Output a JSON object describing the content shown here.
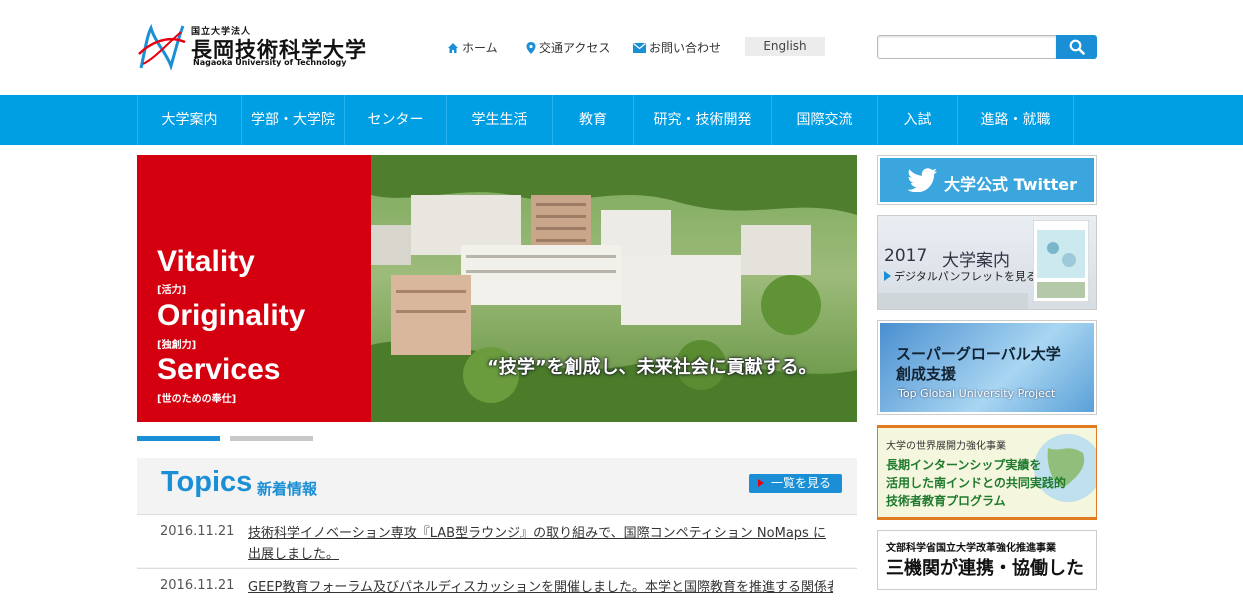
{
  "header": {
    "logo_small": "国立大学法人",
    "logo_main": "長岡技術科学大学",
    "logo_en": "Nagaoka University of Technology",
    "home_label": "ホーム",
    "access_label": "交通アクセス",
    "contact_label": "お問い合わせ",
    "english_label": "English",
    "search_placeholder": ""
  },
  "nav": {
    "items": [
      {
        "label": "大学案内"
      },
      {
        "label": "学部・大学院"
      },
      {
        "label": "センター"
      },
      {
        "label": "学生生活"
      },
      {
        "label": "教育"
      },
      {
        "label": "研究・技術開発"
      },
      {
        "label": "国際交流"
      },
      {
        "label": "入試"
      },
      {
        "label": "進路・就職"
      }
    ]
  },
  "hero": {
    "word1": "Vitality",
    "sub1": "[活力]",
    "word2": "Originality",
    "sub2": "[独創力]",
    "word3": "Services",
    "sub3": "[世のための奉仕]",
    "caption": "“技学”を創成し、未来社会に貢献する。",
    "slide_active": 1,
    "slide_count": 2
  },
  "topics": {
    "title": "Topics",
    "subtitle": "新着情報",
    "more_label": "一覧を見る",
    "items": [
      {
        "date": "2016.11.21",
        "text": "技術科学イノベーション専攻『LAB型ラウンジ』の取り組みで、国際コンペティション NoMaps に出展しました。"
      },
      {
        "date": "2016.11.21",
        "text": "GEEP教育フォーラム及びパネルディスカッションを開催しました。本学と国際教育を推進する関係者の…"
      }
    ]
  },
  "sidebar": {
    "twitter_label": "大学公式 Twitter",
    "pamphlet_year": "2017",
    "pamphlet_title": "大学案内",
    "pamphlet_link": "デジタルパンフレットを見る",
    "sgu_line1": "スーパーグローバル大学",
    "sgu_line2": "創成支援",
    "sgu_en": "Top Global University Project",
    "intern_top": "大学の世界展開力強化事業",
    "intern_line1": "長期インターンシップ実績を",
    "intern_line2": "活用した南インドとの共同実践的",
    "intern_line3": "技術者教育プログラム",
    "mext_top": "文部科学省国立大学改革強化推進事業",
    "mext_main": "三機関が連携・協働した"
  },
  "colors": {
    "brand_blue": "#009ee3",
    "link_blue": "#1a8fd6",
    "hero_red": "#d5000f",
    "twitter_blue": "#3aa6dd"
  }
}
